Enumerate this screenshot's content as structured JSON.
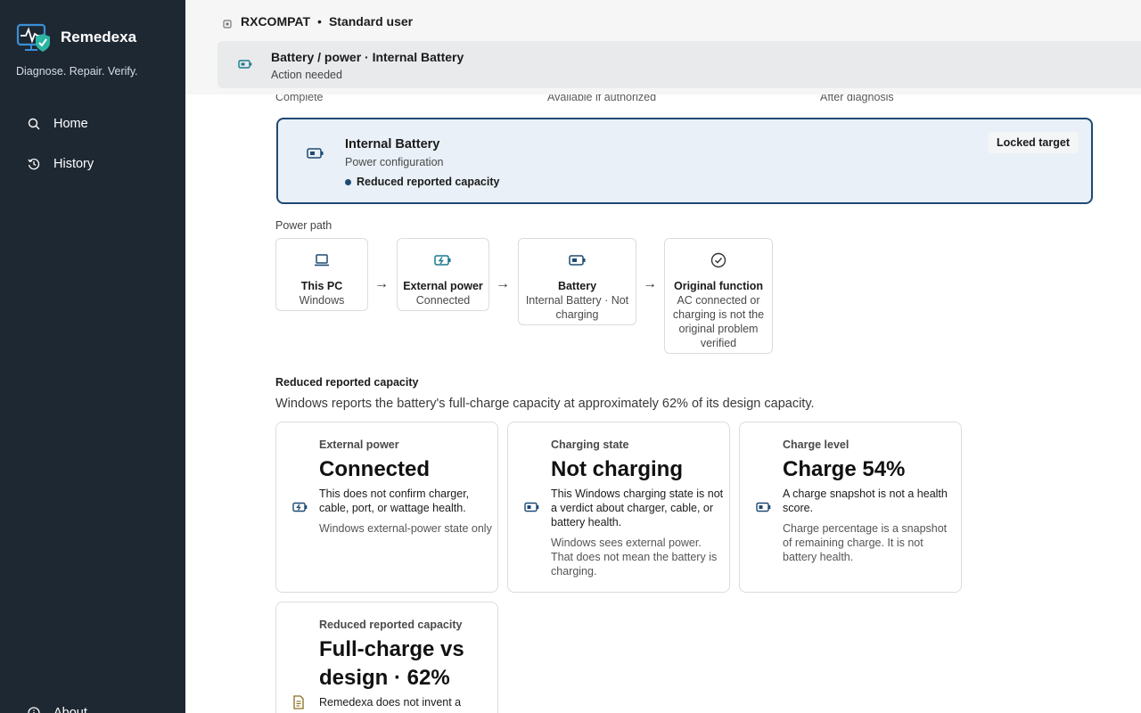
{
  "app": {
    "name": "Remedexa",
    "tagline": "Diagnose. Repair. Verify."
  },
  "sidebar": {
    "items": [
      {
        "label": "Home",
        "icon": "search-icon"
      },
      {
        "label": "History",
        "icon": "history-icon"
      },
      {
        "label": "About",
        "icon": "info-icon"
      }
    ]
  },
  "header": {
    "machine_name": "RXCOMPAT",
    "separator": "•",
    "user_role": "Standard user",
    "banner_title": "Battery / power · Internal Battery",
    "banner_status": "Action needed"
  },
  "steps": [
    "Complete",
    "Available if authorized",
    "After diagnosis"
  ],
  "target": {
    "name": "Internal Battery",
    "category": "Power configuration",
    "status": "Reduced reported capacity",
    "badge": "Locked target"
  },
  "power_path": {
    "label": "Power path",
    "nodes": [
      {
        "title": "This PC",
        "sub": "Windows",
        "icon": "laptop-icon"
      },
      {
        "title": "External power",
        "sub": "Connected",
        "icon": "battery-charging-icon"
      },
      {
        "title": "Battery",
        "sub": "Internal Battery · Not charging",
        "icon": "battery-icon"
      },
      {
        "title": "Original function",
        "sub": "AC connected or charging is not the original problem verified",
        "icon": "check-circle-icon"
      }
    ],
    "arrow": "→"
  },
  "capacity": {
    "title": "Reduced reported capacity",
    "description": "Windows reports the battery's full-charge capacity at approximately 62% of its design capacity."
  },
  "metrics": [
    {
      "label": "External power",
      "value": "Connected",
      "desc": "This does not confirm charger, cable, port, or wattage health.",
      "note": "Windows external-power state only",
      "icon": "battery-charging-icon"
    },
    {
      "label": "Charging state",
      "value": "Not charging",
      "desc": "This Windows charging state is not a verdict about charger, cable, or battery health.",
      "note": "Windows sees external power. That does not mean the battery is charging.",
      "icon": "battery-icon"
    },
    {
      "label": "Charge level",
      "value": "Charge 54%",
      "desc": "A charge snapshot is not a health score.",
      "note": "Charge percentage is a snapshot of remaining charge. It is not battery health.",
      "icon": "battery-icon"
    },
    {
      "label": "Reduced reported capacity",
      "value": "Full-charge vs design · 62%",
      "desc": "Remedexa does not invent a",
      "icon": "document-icon"
    }
  ],
  "colors": {
    "sidebar_bg": "#1e2833",
    "accent": "#1f4a73",
    "teal_icon": "#1a7a8c"
  }
}
